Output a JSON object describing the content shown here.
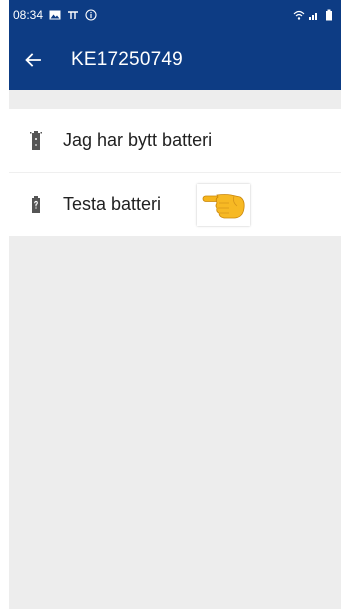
{
  "status_bar": {
    "time": "08:34",
    "icons": [
      "image-icon",
      "pi-icon",
      "info-icon",
      "wifi-icon",
      "signal-icon",
      "battery-icon"
    ]
  },
  "app_bar": {
    "back_icon": "arrow-back-icon",
    "title": "KE17250749"
  },
  "list": {
    "items": [
      {
        "icon": "battery-charging-icon",
        "label": "Jag har bytt batteri"
      },
      {
        "icon": "battery-unknown-icon",
        "label": "Testa batteri",
        "annotation": "pointing-hand-emoji"
      }
    ]
  },
  "colors": {
    "primary": "#0d3c84",
    "background": "#ededed",
    "list_background": "#ffffff",
    "text": "#212121"
  }
}
